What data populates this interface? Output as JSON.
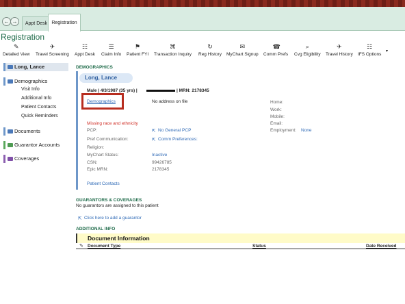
{
  "tabs": {
    "back": "←",
    "forward": "→",
    "appt_desk": "Appt Desk",
    "registration": "Registration"
  },
  "activity_title": "Registration",
  "toolbar": [
    {
      "label": "Detailed View",
      "icon": "✎"
    },
    {
      "label": "Travel Screening",
      "icon": "✈"
    },
    {
      "label": "Appt Desk",
      "icon": "☷"
    },
    {
      "label": "Claim Info",
      "icon": "☰"
    },
    {
      "label": "Patient FYI",
      "icon": "⚑"
    },
    {
      "label": "Transaction Inquiry",
      "icon": "⌘"
    },
    {
      "label": "Reg History",
      "icon": "↻"
    },
    {
      "label": "MyChart Signup",
      "icon": "✉"
    },
    {
      "label": "Comm Prefs",
      "icon": "☎"
    },
    {
      "label": "Cvg Eligibility",
      "icon": "⌕"
    },
    {
      "label": "Travel History",
      "icon": "✈"
    },
    {
      "label": "IFS Options",
      "icon": "☷"
    }
  ],
  "sidebar": {
    "patient": "Long, Lance",
    "demographics": "Demographics",
    "demo_items": [
      "Visit Info",
      "Additional Info",
      "Patient Contacts",
      "Quick Reminders"
    ],
    "documents": "Documents",
    "guarantor": "Guarantor Accounts",
    "coverages": "Coverages"
  },
  "demographics": {
    "header": "DEMOGRAPHICS",
    "name": "Long, Lance",
    "summary_left": "Male | 4/3/1987 (35 yrs) |",
    "summary_right": "| MRN: 2178345",
    "demographics_link": "Demographics",
    "address": "No address on file",
    "missing": "Missing race and ethnicity",
    "labels": {
      "pcp": "PCP:",
      "pref_comm": "Pref Communication:",
      "religion": "Religion:",
      "mychart_status": "MyChart Status:",
      "csn": "CSN:",
      "epic_mrn": "Epic MRN:"
    },
    "values": {
      "pcp": "No General PCP",
      "pref_comm": "Comm Preferences:",
      "mychart_status": "Inactive",
      "csn": "99426785",
      "epic_mrn": "2178345"
    },
    "contact_labels": [
      "Home:",
      "Work:",
      "Mobile:",
      "Email:",
      "Employment:"
    ],
    "employment": "None",
    "patient_contacts": "Patient Contacts"
  },
  "guarantors": {
    "header": "GUARANTORS & COVERAGES",
    "none_text": "No guarantors are assigned to this patient",
    "add_link": "Click here to add a guarantor"
  },
  "additional": {
    "header": "ADDITIONAL INFO",
    "doc_info": "Document Information",
    "columns": [
      "Document Type",
      "Status",
      "Date Received"
    ]
  },
  "colors": {
    "accent_green": "#1f6b4a",
    "link_blue": "#2f6ab6",
    "highlight_red": "#b72d1f",
    "demographics_bar": "#6e97c9"
  }
}
